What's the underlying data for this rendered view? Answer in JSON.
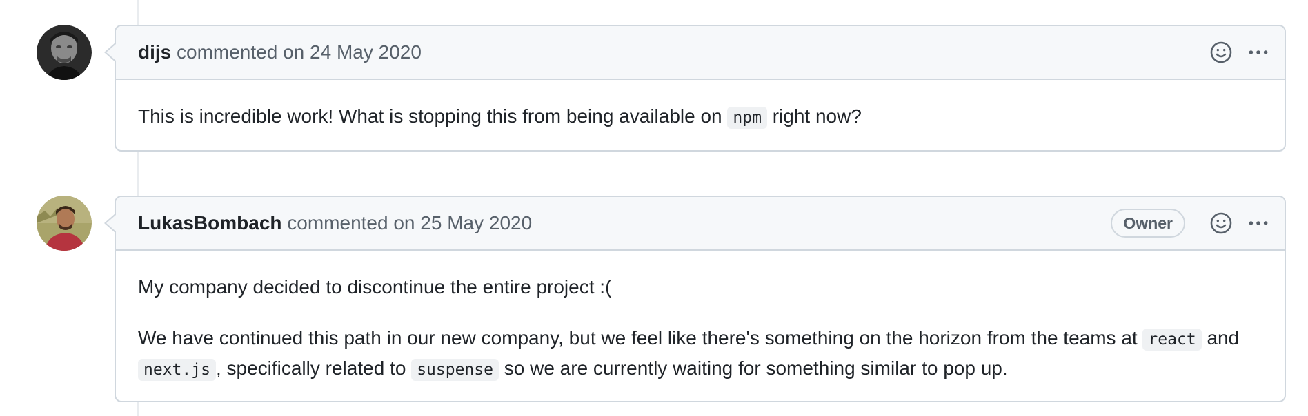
{
  "comments": [
    {
      "author": "dijs",
      "action": "commented on",
      "date": "24 May 2020",
      "badge": "",
      "paragraphs": [
        {
          "before": "This is incredible work! What is stopping this from being available on ",
          "code": "npm",
          "after": " right now?"
        }
      ]
    },
    {
      "author": "LukasBombach",
      "action": "commented on",
      "date": "25 May 2020",
      "badge": "Owner",
      "paragraphs": [
        {
          "text": "My company decided to discontinue the entire project :("
        },
        {
          "t1": "We have continued this path in our new company, but we feel like there's something on the horizon from the teams at ",
          "c1": "react",
          "t2": " and ",
          "c2": "next.js",
          "t3": ", specifically related to ",
          "c3": "suspense",
          "t4": " so we are currently waiting for something similar to pop up."
        }
      ]
    }
  ],
  "icons": {
    "reaction": "smiley-icon",
    "more": "kebab-horizontal-icon"
  },
  "colors": {
    "header_bg": "#f6f8fa",
    "border": "#d0d7de",
    "muted_text": "#57606a",
    "code_bg": "#eff1f3"
  }
}
